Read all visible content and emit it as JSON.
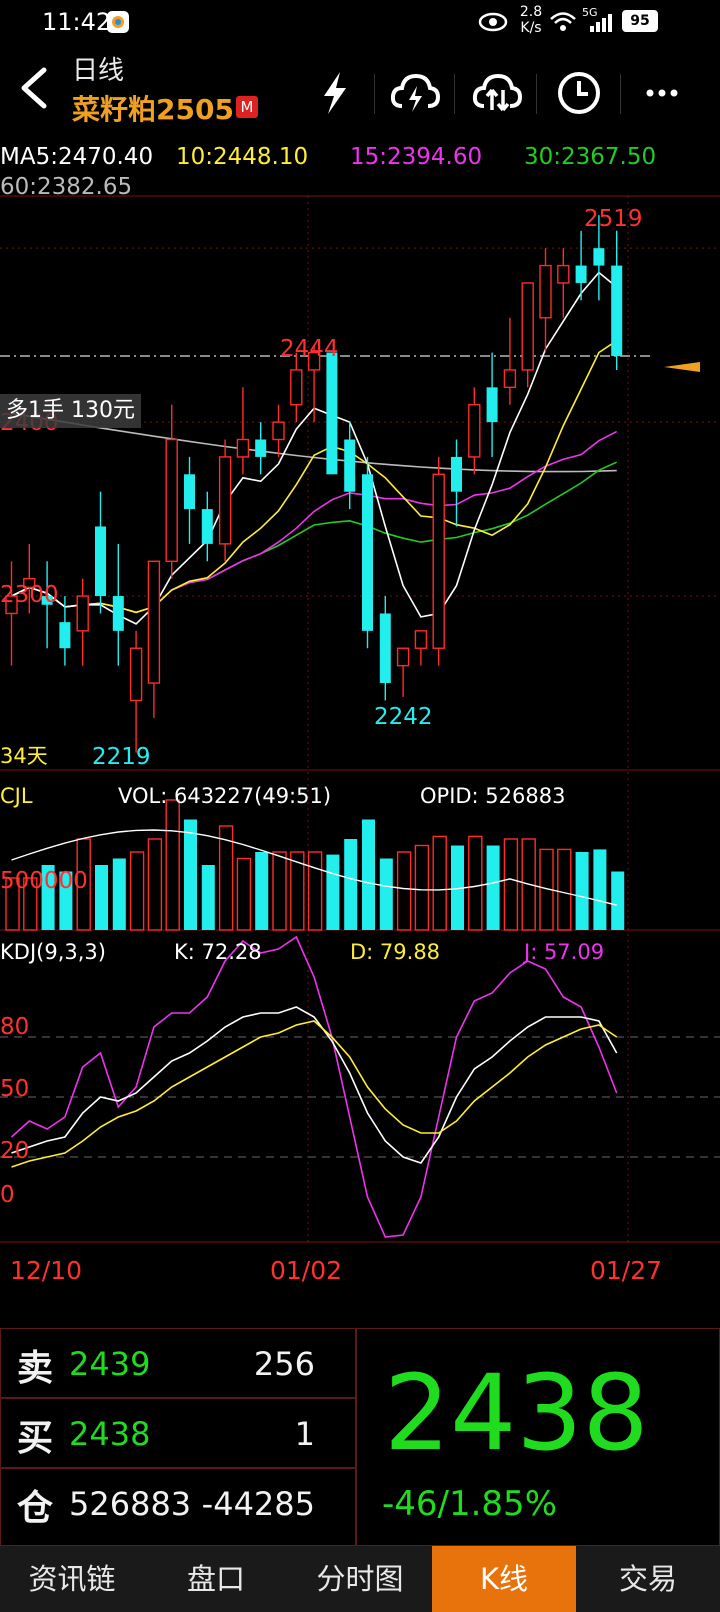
{
  "status": {
    "time": "11:42",
    "net_speed_top": "2.8",
    "net_speed_bottom": "K/s",
    "battery": "95",
    "signal_label": "5G"
  },
  "header": {
    "title": "日线",
    "symbol": "菜籽粕2505",
    "badge": "M"
  },
  "ma": {
    "ma5": "MA5:2470.40",
    "ma10": "10:2448.10",
    "ma15": "15:2394.60",
    "ma30": "30:2367.50",
    "ma60": "60:2382.65"
  },
  "colors": {
    "up": "#ff2a2a",
    "down": "#22eeee",
    "ma5": "#ffffff",
    "ma10": "#ffee33",
    "ma15": "#ee33ee",
    "ma30": "#22cc22",
    "ma60": "#bbbbbb",
    "price_green": "#1fdc1f",
    "accent": "#e8720c"
  },
  "price_chart": {
    "labels": {
      "high": "2519",
      "high2": "2444",
      "low1": "2219",
      "low2": "2242",
      "level1": "2400",
      "level2": "2300",
      "days": "34天"
    },
    "position_tag": "多1手  130元"
  },
  "volume": {
    "title": "CJL",
    "vol": "VOL: 643227(49:51)",
    "opid": "OPID: 526883",
    "axis": "500000"
  },
  "kdj": {
    "title": "KDJ(9,3,3)",
    "k": "K: 72.28",
    "d": "D: 79.88",
    "j": "J: 57.09",
    "lv80": "80",
    "lv50": "50",
    "lv20": "20",
    "lv0": "0"
  },
  "dates": {
    "d1": "12/10",
    "d2": "01/02",
    "d3": "01/27"
  },
  "chart_data": {
    "type": "candlestick",
    "candles": [
      [
        2290,
        2320,
        2260,
        2300
      ],
      [
        2305,
        2330,
        2290,
        2310
      ],
      [
        2300,
        2320,
        2270,
        2295
      ],
      [
        2285,
        2300,
        2260,
        2270
      ],
      [
        2280,
        2310,
        2260,
        2300
      ],
      [
        2340,
        2360,
        2290,
        2300
      ],
      [
        2300,
        2330,
        2260,
        2280
      ],
      [
        2240,
        2280,
        2210,
        2270
      ],
      [
        2250,
        2280,
        2230,
        2320
      ],
      [
        2320,
        2410,
        2310,
        2390
      ],
      [
        2370,
        2380,
        2330,
        2350
      ],
      [
        2350,
        2360,
        2320,
        2330
      ],
      [
        2330,
        2390,
        2320,
        2380
      ],
      [
        2380,
        2420,
        2370,
        2390
      ],
      [
        2390,
        2400,
        2370,
        2380
      ],
      [
        2390,
        2410,
        2380,
        2400
      ],
      [
        2410,
        2440,
        2400,
        2430
      ],
      [
        2430,
        2444,
        2400,
        2440
      ],
      [
        2440,
        2430,
        2380,
        2370
      ],
      [
        2390,
        2400,
        2350,
        2360
      ],
      [
        2370,
        2380,
        2270,
        2280
      ],
      [
        2290,
        2300,
        2240,
        2250
      ],
      [
        2260,
        2270,
        2242,
        2270
      ],
      [
        2270,
        2280,
        2260,
        2280
      ],
      [
        2270,
        2380,
        2260,
        2370
      ],
      [
        2380,
        2390,
        2340,
        2360
      ],
      [
        2380,
        2420,
        2370,
        2410
      ],
      [
        2420,
        2440,
        2380,
        2400
      ],
      [
        2420,
        2460,
        2410,
        2430
      ],
      [
        2430,
        2480,
        2420,
        2480
      ],
      [
        2460,
        2500,
        2440,
        2490
      ],
      [
        2480,
        2500,
        2460,
        2490
      ],
      [
        2490,
        2510,
        2470,
        2480
      ],
      [
        2500,
        2519,
        2470,
        2490
      ],
      [
        2490,
        2510,
        2430,
        2438
      ]
    ],
    "volume_scale": [
      0,
      1000000
    ],
    "ylim": [
      2200,
      2530
    ]
  },
  "quote": {
    "sell_label": "卖",
    "sell_price": "2439",
    "sell_qty": "256",
    "buy_label": "买",
    "buy_price": "2438",
    "buy_qty": "1",
    "oi_label": "仓",
    "oi_value": "526883",
    "oi_change": "-44285",
    "last": "2438",
    "change": "-46/1.85%"
  },
  "tabs": [
    {
      "label": "资讯链"
    },
    {
      "label": "盘口"
    },
    {
      "label": "分时图"
    },
    {
      "label": "K线",
      "active": true
    },
    {
      "label": "交易"
    }
  ]
}
